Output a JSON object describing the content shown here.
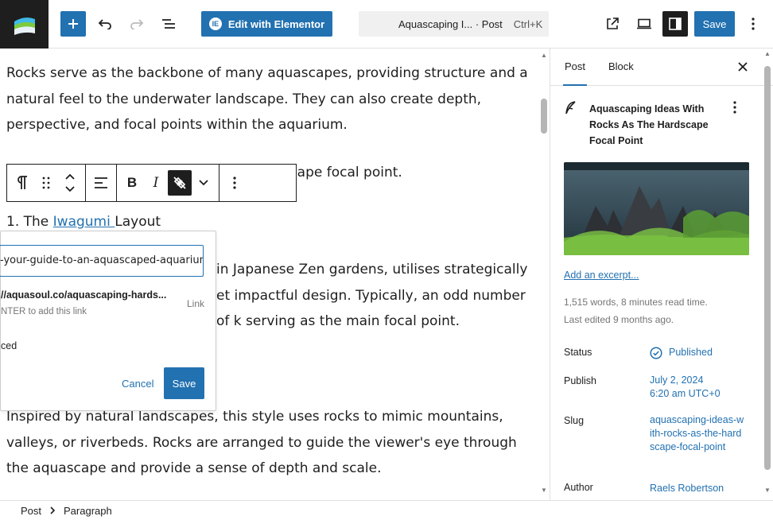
{
  "topbar": {
    "elementor_label": "Edit with Elementor",
    "elementor_badge": "IE",
    "command_title": "Aquascaping I... · Post",
    "command_shortcut": "Ctrl+K",
    "save_label": "Save"
  },
  "editor": {
    "paragraph1": "Rocks serve as the backbone of many aquascapes, providing structure and a natural feel to the underwater landscape. They can also create depth, perspective, and focal points within the aquarium.",
    "paragraph2_visible": "rdscape focal point.",
    "list_prefix": "1. The ",
    "list_link": "Iwagumi ",
    "list_suffix": "Layout",
    "paragraph4_visible": "in Japanese Zen gardens, utilises strategically et impactful design. Typically, an odd number of k serving as the main focal point.",
    "paragraph5": "Inspired by natural landscapes, this style uses rocks to mimic mountains, valleys, or riverbeds. Rocks are arranged to guide the viewer's eye through the aquascape and provide a sense of depth and scale."
  },
  "link_popover": {
    "input_value": "-your-guide-to-an-aquascaped-aquarium/",
    "suggestion_url": "//aquasoul.co/aquascaping-hards...",
    "suggestion_hint": "NTER to add this link",
    "suggestion_type": "Link",
    "advanced_label": "ced",
    "cancel_label": "Cancel",
    "save_label": "Save"
  },
  "sidebar": {
    "tab_post": "Post",
    "tab_block": "Block",
    "post_title": "Aquascaping Ideas With Rocks As The Hardscape Focal Point",
    "excerpt_link": "Add an excerpt...",
    "word_count": "1,515 words, 8 minutes read time.",
    "last_edited": "Last edited 9 months ago.",
    "status_label": "Status",
    "status_value": "Published",
    "publish_label": "Publish",
    "publish_date": "July 2, 2024",
    "publish_time": "6:20 am UTC+0",
    "slug_label": "Slug",
    "slug_value": "aquascaping-ideas-with-rocks-as-the-hardscape-focal-point",
    "author_label": "Author",
    "author_value": "Raels Robertson"
  },
  "footer": {
    "crumb1": "Post",
    "crumb2": "Paragraph"
  },
  "colors": {
    "accent": "#2271b1",
    "dark": "#1e1e1e",
    "muted": "#757575"
  }
}
